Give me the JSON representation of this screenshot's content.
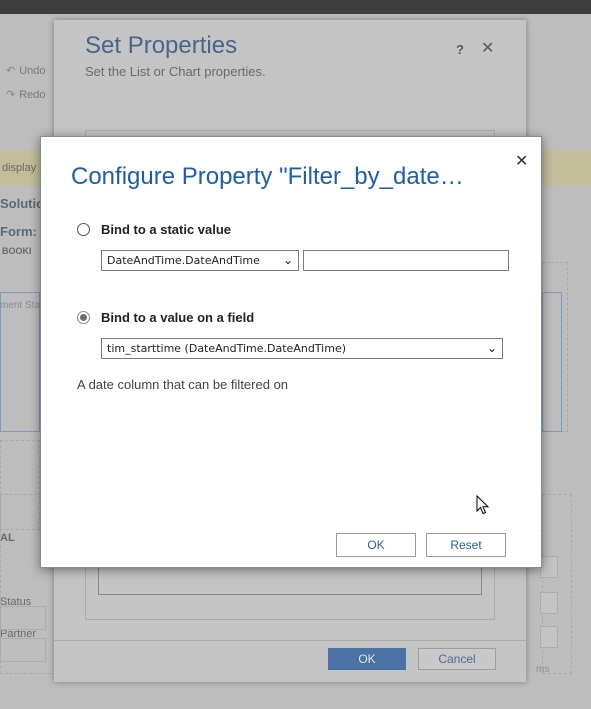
{
  "background": {
    "ribbon": {
      "undo_label": "Undo",
      "redo_label": "Redo"
    },
    "notice_text": "display",
    "solution_label": "Solutio",
    "form_label": "Form:",
    "booking_label": "BOOKI",
    "comment_label": "ment Sta",
    "general_label": "AL",
    "status_label": "Status",
    "partner_label": "Partner",
    "ms_label": "ms"
  },
  "set_properties": {
    "title": "Set Properties",
    "subtitle": "Set the List or Chart properties.",
    "help_label": "?",
    "close_label": "✕",
    "ok_label": "OK",
    "cancel_label": "Cancel"
  },
  "configure": {
    "title": "Configure Property \"Filter_by_date…",
    "close_label": "✕",
    "static_option": {
      "label": "Bind to a static value",
      "selected": false,
      "type_select_value": "DateAndTime.DateAndTime",
      "value_input": ""
    },
    "field_option": {
      "label": "Bind to a value on a field",
      "selected": true,
      "field_select_value": "tim_starttime (DateAndTime.DateAndTime)"
    },
    "description": "A date column that can be filtered on",
    "ok_label": "OK",
    "reset_label": "Reset"
  },
  "icons": {
    "dropdown": "chevron-down-icon",
    "close": "close-icon",
    "cursor": "mouse-pointer-icon"
  }
}
